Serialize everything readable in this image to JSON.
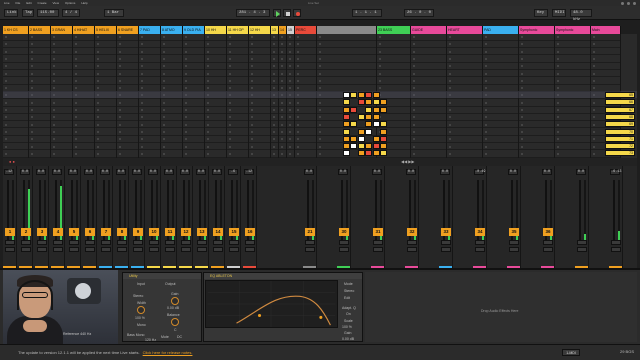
{
  "app": {
    "title": "Live Set",
    "menu": [
      "Live",
      "File",
      "Edit",
      "Create",
      "View",
      "Options",
      "Help"
    ]
  },
  "transport": {
    "link": "Link",
    "tap": "Tap",
    "tempo": "115.00",
    "signature": "4 / 4",
    "quantize": "1 Bar",
    "position": "281 . 4 . 3",
    "loop_start": "1 . 1 . 1",
    "loop_length": "26 . 0 . 0",
    "key": "Key",
    "midi": "MIDI",
    "sample_rate": "48.0 kHz"
  },
  "tracks": [
    {
      "name": "1 KH CS",
      "color": "#f0a020"
    },
    {
      "name": "2 BASS",
      "color": "#f0a020"
    },
    {
      "name": "3 GRAN",
      "color": "#f0a020"
    },
    {
      "name": "4 HIHAT",
      "color": "#f0a020"
    },
    {
      "name": "5 HELIX",
      "color": "#f0a020"
    },
    {
      "name": "6 SNARE",
      "color": "#f0a020"
    },
    {
      "name": "7 PAD",
      "color": "#3ab0f0"
    },
    {
      "name": "8 ATMO",
      "color": "#3ab0f0"
    },
    {
      "name": "9 OLD PIA",
      "color": "#3ab0f0"
    },
    {
      "name": "10 HH",
      "color": "#f5d84a"
    },
    {
      "name": "11 HH OP",
      "color": "#f5d84a"
    },
    {
      "name": "12 HH",
      "color": "#f5d84a"
    },
    {
      "name": "13",
      "color": "#f5d84a"
    },
    {
      "name": "14",
      "color": "#f0a020"
    },
    {
      "name": "15",
      "color": "#d0d0d0"
    },
    {
      "name": "PERC",
      "color": "#e84a3a"
    },
    {
      "name": "",
      "color": "#8a8a8a"
    },
    {
      "name": "23 BASS",
      "color": "#3fcf55"
    },
    {
      "name": "GUIDE",
      "color": "#e84a9a"
    },
    {
      "name": "HEART",
      "color": "#e84a9a"
    },
    {
      "name": "PAD",
      "color": "#3ab0f0"
    },
    {
      "name": "Symphonic",
      "color": "#e84a9a"
    },
    {
      "name": "Symphonic",
      "color": "#e84a9a"
    },
    {
      "name": "Main",
      "color": "#e84a9a"
    }
  ],
  "scenes": [
    "1",
    "2",
    "3",
    "4",
    "5",
    "6",
    "7",
    "8",
    "9",
    "10",
    "11",
    "12",
    "13",
    "14",
    "15",
    "16",
    "17"
  ],
  "scene_labels": [
    "65",
    "66",
    "67",
    "68",
    "69",
    "70",
    "71",
    "72",
    "73",
    "74"
  ],
  "mixer": {
    "volumes": [
      "-12",
      "0.0",
      "0.0",
      "0.0",
      "0.0",
      "0.0",
      "0.0",
      "0.0",
      "0.0",
      "0.0",
      "0.0",
      "0.0",
      "0.0",
      "0.0",
      "-6",
      "-12",
      "0.0",
      "0.0",
      "0.0",
      "0.0",
      "0.0",
      "-0.49",
      "0.0",
      "0.0",
      "0.0",
      "-6.13"
    ],
    "track_numbers": [
      "1",
      "2",
      "3",
      "4",
      "5",
      "6",
      "7",
      "8",
      "9",
      "10",
      "11",
      "12",
      "13",
      "14",
      "15",
      "16",
      "21",
      "30",
      "31",
      "32",
      "33",
      "34",
      "35",
      "36"
    ]
  },
  "devices": {
    "webcam_caption": "Reference 440 Hz",
    "utility": {
      "title": "Utility",
      "input": "Input",
      "output": "Output",
      "stereo": "Stereo",
      "width": "Width",
      "width_val": "100 %",
      "mono": "Mono",
      "bass_mono": "Bass Mono",
      "gain": "Gain",
      "gain_val": "0.00 dB",
      "balance": "Balance",
      "balance_val": "C",
      "mute": "Mute",
      "dc": "DC",
      "freq": "120 Hz"
    },
    "eq": {
      "title": "EQ ABLETON",
      "mode": "Mode",
      "stereo": "Stereo",
      "edit": "Edit",
      "adapt": "Adapt. Q",
      "on": "On",
      "scale": "Scale",
      "scale_val": "100 %",
      "gain": "Gain",
      "gain_val": "0.00 dB",
      "freq": "17.8 kHz"
    },
    "drop_text": "Drop Audio Effects Here"
  },
  "status": {
    "message": "The update to version 12.1.1 will be applied the next time Live starts.",
    "link": "Click here for release notes.",
    "cpu": "29 BGS",
    "pattern": "1-MDI"
  },
  "colors": {
    "orange": "#f0a020",
    "blue": "#3ab0f0",
    "yellow": "#f5d84a",
    "green": "#3fcf55",
    "red": "#e84a3a",
    "pink": "#e84a9a"
  }
}
